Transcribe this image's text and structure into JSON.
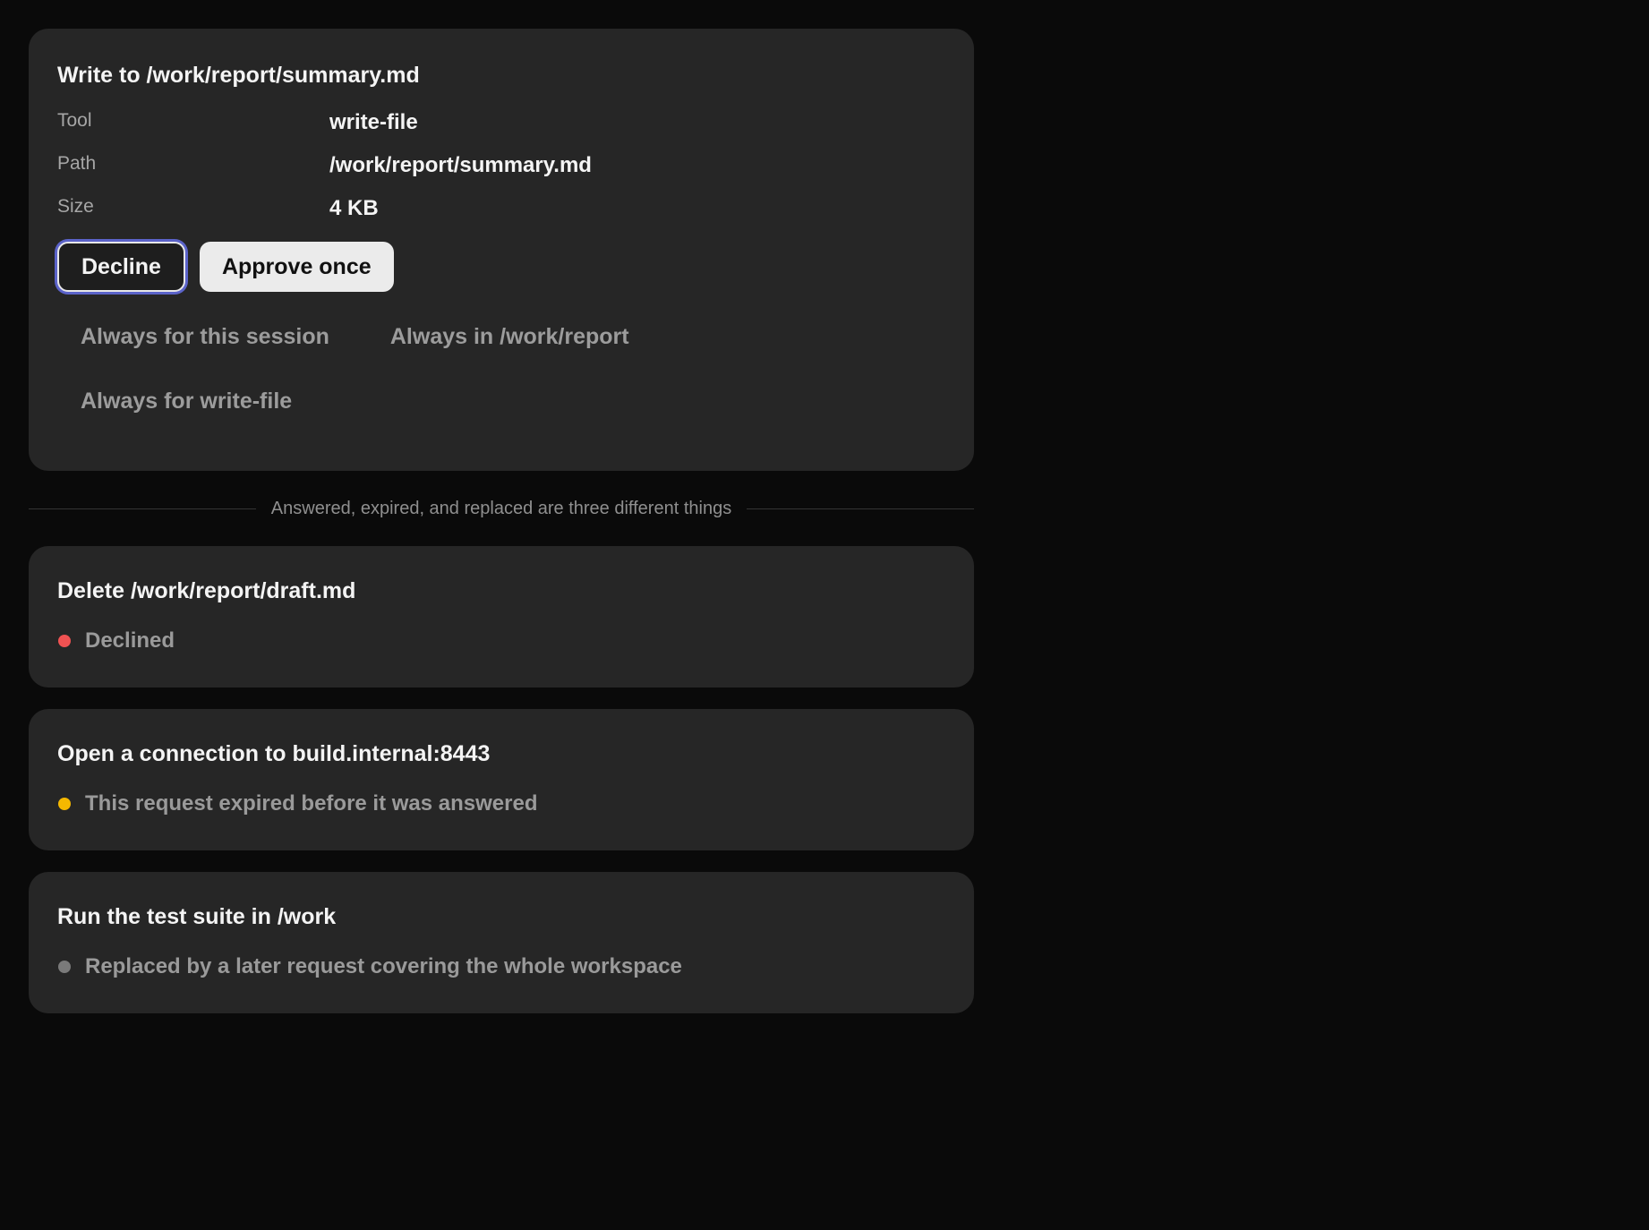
{
  "pending_request": {
    "title": "Write to /work/report/summary.md",
    "details": [
      {
        "key": "Tool",
        "value": "write-file"
      },
      {
        "key": "Path",
        "value": "/work/report/summary.md"
      },
      {
        "key": "Size",
        "value": "4 KB"
      }
    ],
    "buttons": {
      "decline": "Decline",
      "approve_once": "Approve once"
    },
    "options": {
      "session": "Always for this session",
      "directory": "Always in /work/report",
      "tool": "Always for write-file"
    }
  },
  "divider": {
    "text": "Answered, expired, and replaced are three different things"
  },
  "resolved_requests": [
    {
      "title": "Delete /work/report/draft.md",
      "status": "Declined",
      "dot_color": "#f05252"
    },
    {
      "title": "Open a connection to build.internal:8443",
      "status": "This request expired before it was answered",
      "dot_color": "#f5b800"
    },
    {
      "title": "Run the test suite in /work",
      "status": "Replaced by a later request covering the whole workspace",
      "dot_color": "#7a7a7a"
    }
  ]
}
